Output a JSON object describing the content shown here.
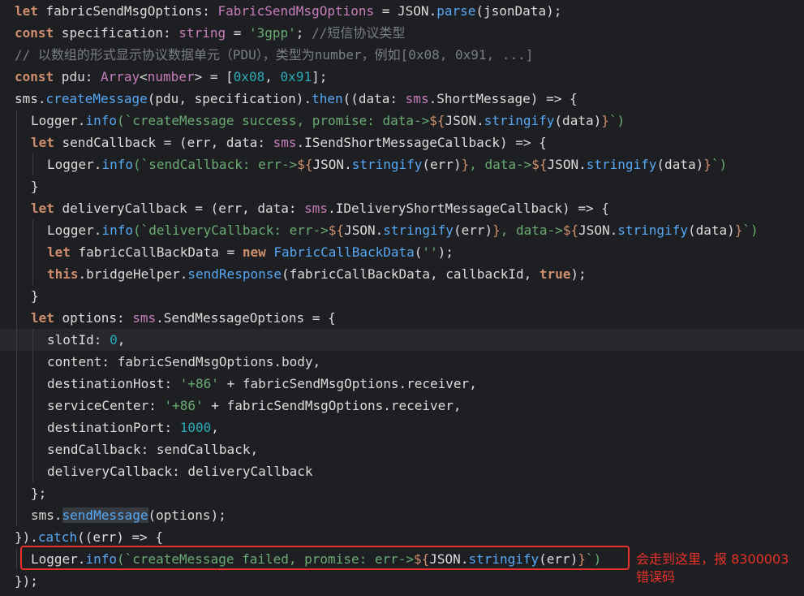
{
  "editor": {
    "lines": [
      {
        "indent": 0,
        "tokens": [
          [
            "kw",
            "let"
          ],
          [
            "plain",
            " fabricSendMsgOptions"
          ],
          [
            "plain",
            ": "
          ],
          [
            "type",
            "FabricSendMsgOptions"
          ],
          [
            "plain",
            " = "
          ],
          [
            "plain",
            "JSON"
          ],
          [
            "plain",
            "."
          ],
          [
            "fn",
            "parse"
          ],
          [
            "plain",
            "(jsonData);"
          ]
        ]
      },
      {
        "indent": 0,
        "tokens": [
          [
            "kw",
            "const"
          ],
          [
            "plain",
            " specification"
          ],
          [
            "plain",
            ": "
          ],
          [
            "type",
            "string"
          ],
          [
            "plain",
            " = "
          ],
          [
            "str",
            "'3gpp'"
          ],
          [
            "plain",
            "; "
          ],
          [
            "comment",
            "//短信协议类型"
          ]
        ]
      },
      {
        "indent": 0,
        "tokens": [
          [
            "comment",
            "// 以数组的形式显示协议数据单元（PDU），类型为number，例如[0x08, 0x91, ...]"
          ]
        ]
      },
      {
        "indent": 0,
        "tokens": [
          [
            "kw",
            "const"
          ],
          [
            "plain",
            " pdu"
          ],
          [
            "plain",
            ": "
          ],
          [
            "type",
            "Array"
          ],
          [
            "plain",
            "<"
          ],
          [
            "type",
            "number"
          ],
          [
            "plain",
            "> = ["
          ],
          [
            "num",
            "0x08"
          ],
          [
            "plain",
            ", "
          ],
          [
            "num",
            "0x91"
          ],
          [
            "plain",
            "];"
          ]
        ]
      },
      {
        "indent": 0,
        "tokens": [
          [
            "plain",
            "sms"
          ],
          [
            "plain",
            "."
          ],
          [
            "fn",
            "createMessage"
          ],
          [
            "plain",
            "(pdu, specification)."
          ],
          [
            "fn",
            "then"
          ],
          [
            "plain",
            "((data: "
          ],
          [
            "ns",
            "sms"
          ],
          [
            "plain",
            ".ShortMessage) => {"
          ]
        ]
      },
      {
        "indent": 1,
        "tokens": [
          [
            "plain",
            "Logger"
          ],
          [
            "plain",
            "."
          ],
          [
            "fn",
            "info"
          ],
          [
            "templ",
            "(`createMessage success, promise: data->"
          ],
          [
            "interp",
            "${"
          ],
          [
            "plain",
            "JSON"
          ],
          [
            "plain",
            "."
          ],
          [
            "fn",
            "stringify"
          ],
          [
            "plain",
            "(data)"
          ],
          [
            "interp",
            "}"
          ],
          [
            "templ",
            "`)"
          ]
        ]
      },
      {
        "indent": 1,
        "tokens": [
          [
            "kw",
            "let"
          ],
          [
            "plain",
            " sendCallback = (err, data: "
          ],
          [
            "ns",
            "sms"
          ],
          [
            "plain",
            ".ISendShortMessageCallback) => {"
          ]
        ]
      },
      {
        "indent": 2,
        "tokens": [
          [
            "plain",
            "Logger"
          ],
          [
            "plain",
            "."
          ],
          [
            "fn",
            "info"
          ],
          [
            "templ",
            "(`sendCallback: err->"
          ],
          [
            "interp",
            "${"
          ],
          [
            "plain",
            "JSON"
          ],
          [
            "plain",
            "."
          ],
          [
            "fn",
            "stringify"
          ],
          [
            "plain",
            "(err)"
          ],
          [
            "interp",
            "}"
          ],
          [
            "templ",
            ", data->"
          ],
          [
            "interp",
            "${"
          ],
          [
            "plain",
            "JSON"
          ],
          [
            "plain",
            "."
          ],
          [
            "fn",
            "stringify"
          ],
          [
            "plain",
            "(data)"
          ],
          [
            "interp",
            "}"
          ],
          [
            "templ",
            "`)"
          ]
        ]
      },
      {
        "indent": 1,
        "tokens": [
          [
            "plain",
            "}"
          ]
        ]
      },
      {
        "indent": 1,
        "tokens": [
          [
            "kw",
            "let"
          ],
          [
            "plain",
            " deliveryCallback = (err, data: "
          ],
          [
            "ns",
            "sms"
          ],
          [
            "plain",
            ".IDeliveryShortMessageCallback) => {"
          ]
        ]
      },
      {
        "indent": 2,
        "tokens": [
          [
            "plain",
            "Logger"
          ],
          [
            "plain",
            "."
          ],
          [
            "fn",
            "info"
          ],
          [
            "templ",
            "(`deliveryCallback: err->"
          ],
          [
            "interp",
            "${"
          ],
          [
            "plain",
            "JSON"
          ],
          [
            "plain",
            "."
          ],
          [
            "fn",
            "stringify"
          ],
          [
            "plain",
            "(err)"
          ],
          [
            "interp",
            "}"
          ],
          [
            "templ",
            ", data->"
          ],
          [
            "interp",
            "${"
          ],
          [
            "plain",
            "JSON"
          ],
          [
            "plain",
            "."
          ],
          [
            "fn",
            "stringify"
          ],
          [
            "plain",
            "(data)"
          ],
          [
            "interp",
            "}"
          ],
          [
            "templ",
            "`)"
          ]
        ]
      },
      {
        "indent": 2,
        "tokens": [
          [
            "kw",
            "let"
          ],
          [
            "plain",
            " fabricCallBackData = "
          ],
          [
            "kw",
            "new"
          ],
          [
            "plain",
            " "
          ],
          [
            "fn",
            "FabricCallBackData"
          ],
          [
            "plain",
            "("
          ],
          [
            "str",
            "''"
          ],
          [
            "plain",
            ");"
          ]
        ]
      },
      {
        "indent": 2,
        "tokens": [
          [
            "this",
            "this"
          ],
          [
            "plain",
            ".bridgeHelper."
          ],
          [
            "fn",
            "sendResponse"
          ],
          [
            "plain",
            "(fabricCallBackData, callbackId, "
          ],
          [
            "bool",
            "true"
          ],
          [
            "plain",
            ");"
          ]
        ]
      },
      {
        "indent": 1,
        "tokens": [
          [
            "plain",
            "}"
          ]
        ]
      },
      {
        "indent": 1,
        "tokens": [
          [
            "kw",
            "let"
          ],
          [
            "plain",
            " options: "
          ],
          [
            "ns",
            "sms"
          ],
          [
            "plain",
            ".SendMessageOptions = {"
          ]
        ]
      },
      {
        "indent": 2,
        "highlight": true,
        "tokens": [
          [
            "plain",
            "slotId: "
          ],
          [
            "num",
            "0"
          ],
          [
            "plain",
            ","
          ]
        ]
      },
      {
        "indent": 2,
        "tokens": [
          [
            "plain",
            "content: fabricSendMsgOptions.body,"
          ]
        ]
      },
      {
        "indent": 2,
        "tokens": [
          [
            "plain",
            "destinationHost: "
          ],
          [
            "str",
            "'+86'"
          ],
          [
            "plain",
            " + fabricSendMsgOptions.receiver,"
          ]
        ]
      },
      {
        "indent": 2,
        "tokens": [
          [
            "plain",
            "serviceCenter: "
          ],
          [
            "str",
            "'+86'"
          ],
          [
            "plain",
            " + fabricSendMsgOptions.receiver,"
          ]
        ]
      },
      {
        "indent": 2,
        "tokens": [
          [
            "plain",
            "destinationPort: "
          ],
          [
            "num",
            "1000"
          ],
          [
            "plain",
            ","
          ]
        ]
      },
      {
        "indent": 2,
        "tokens": [
          [
            "plain",
            "sendCallback: sendCallback,"
          ]
        ]
      },
      {
        "indent": 2,
        "tokens": [
          [
            "plain",
            "deliveryCallback: deliveryCallback"
          ]
        ]
      },
      {
        "indent": 1,
        "tokens": [
          [
            "plain",
            "};"
          ]
        ]
      },
      {
        "indent": 1,
        "tokens": [
          [
            "plain",
            "sms."
          ],
          [
            "fnmark",
            "sendMessage"
          ],
          [
            "plain",
            "(options);"
          ]
        ]
      },
      {
        "indent": 0,
        "tokens": [
          [
            "plain",
            "})."
          ],
          [
            "fn",
            "catch"
          ],
          [
            "plain",
            "((err) => {"
          ]
        ]
      },
      {
        "indent": 1,
        "tokens": [
          [
            "plain",
            "Logger"
          ],
          [
            "plain",
            "."
          ],
          [
            "fn",
            "info"
          ],
          [
            "templ",
            "(`createMessage failed, promise: err->"
          ],
          [
            "interp",
            "${"
          ],
          [
            "plain",
            "JSON"
          ],
          [
            "plain",
            "."
          ],
          [
            "fn",
            "stringify"
          ],
          [
            "plain",
            "(err)"
          ],
          [
            "interp",
            "}"
          ],
          [
            "templ",
            "`)"
          ]
        ]
      },
      {
        "indent": 0,
        "tokens": [
          [
            "plain",
            "});"
          ]
        ]
      }
    ]
  },
  "annotation": {
    "text_line1": "会走到这里，报 8300003",
    "text_line2": "错误码",
    "color": "#e8312a"
  },
  "colors": {
    "background": "#1e1f22",
    "keyword": "#cf8e6d",
    "function": "#56a8f5",
    "string": "#6aab73",
    "number": "#2aacb8",
    "comment": "#7a7e85",
    "type": "#c77dbb"
  }
}
